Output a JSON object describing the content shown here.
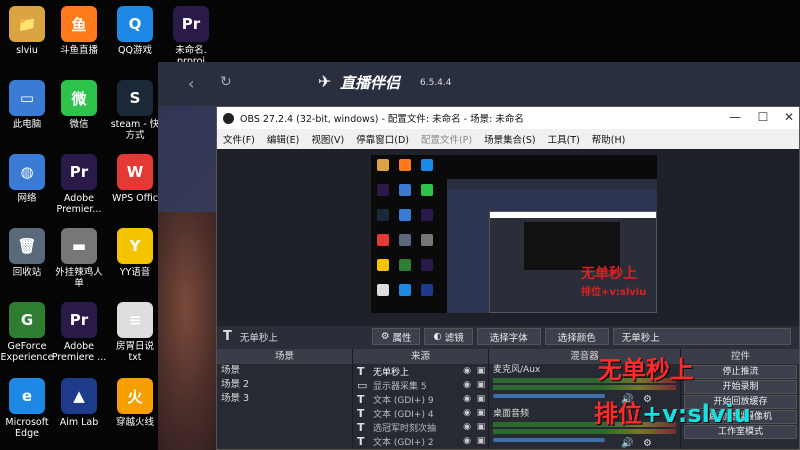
{
  "desktop": {
    "icons": [
      {
        "label": "slviu",
        "glyph": "📁",
        "color": "#d9a441"
      },
      {
        "label": "斗鱼直播",
        "glyph": "鱼",
        "color": "#ff7a1a"
      },
      {
        "label": "QQ游戏",
        "glyph": "Q",
        "color": "#1e88e5"
      },
      {
        "label": "未命名.\nprproj",
        "glyph": "Pr",
        "color": "#2a1a4a"
      },
      {
        "label": "此电脑",
        "glyph": "▭",
        "color": "#3a7bd5"
      },
      {
        "label": "微信",
        "glyph": "微",
        "color": "#2ec44b"
      },
      {
        "label": "steam - 快\n方式",
        "glyph": "S",
        "color": "#1b2838"
      },
      {
        "label": "网络",
        "glyph": "◍",
        "color": "#3a7bd5"
      },
      {
        "label": "Adobe\nPremier...",
        "glyph": "Pr",
        "color": "#2a1a4a"
      },
      {
        "label": "WPS Offic",
        "glyph": "W",
        "color": "#e53935"
      },
      {
        "label": "回收站",
        "glyph": "🗑",
        "color": "#5a6a7a"
      },
      {
        "label": "外挂辣鸡人\n单",
        "glyph": "▬",
        "color": "#777"
      },
      {
        "label": "YY语音",
        "glyph": "Y",
        "color": "#f5c400"
      },
      {
        "label": "GeForce\nExperience",
        "glyph": "G",
        "color": "#2e7d32"
      },
      {
        "label": "Adobe\nPremiere ...",
        "glyph": "Pr",
        "color": "#2a1a4a"
      },
      {
        "label": "房胃日说\ntxt",
        "glyph": "≡",
        "color": "#ddd"
      },
      {
        "label": "Microsoft\nEdge",
        "glyph": "e",
        "color": "#1e88e5"
      },
      {
        "label": "Aim Lab",
        "glyph": "▲",
        "color": "#1e3a8a"
      },
      {
        "label": "穿越火线",
        "glyph": "火",
        "color": "#f5a000"
      }
    ]
  },
  "zhibo": {
    "title": "直播伴侣",
    "version": "6.5.4.4"
  },
  "obs": {
    "title": "OBS 27.2.4 (32-bit, windows) - 配置文件: 未命名 - 场景: 未命名",
    "menu": [
      "文件(F)",
      "编辑(E)",
      "视图(V)",
      "停靠窗口(D)",
      "配置文件(P)",
      "场景集合(S)",
      "工具(T)",
      "帮助(H)"
    ],
    "toolbar": {
      "source_name": "无单秒上",
      "properties": "属性",
      "filters": "滤镜",
      "select_font": "选择字体",
      "select_color": "选择颜色",
      "text_value": "无单秒上"
    },
    "scenes": {
      "header": "场景",
      "items": [
        "场景",
        "场景 2",
        "场景 3"
      ]
    },
    "sources": {
      "header": "来源",
      "items": [
        "无单秒上",
        "显示器采集 5",
        "文本 (GDI+) 9",
        "文本 (GDI+) 4",
        "选冠军时刻次抽",
        "文本 (GDI+) 2"
      ]
    },
    "mixer": {
      "header": "混音器",
      "channels": [
        {
          "name": "麦克风/Aux"
        },
        {
          "name": "桌面音频"
        }
      ]
    },
    "controls": {
      "header": "控件",
      "buttons": [
        "停止推流",
        "开始录制",
        "开始回放缓存",
        "启动虚拟摄像机",
        "工作室模式"
      ]
    }
  },
  "overlay": {
    "line1": "无单秒上",
    "line2_red": "排位",
    "line2_cyan": "+v:slviu"
  },
  "preview_overlay": {
    "line1": "无单秒上",
    "line2": "排位+v:slviu"
  }
}
